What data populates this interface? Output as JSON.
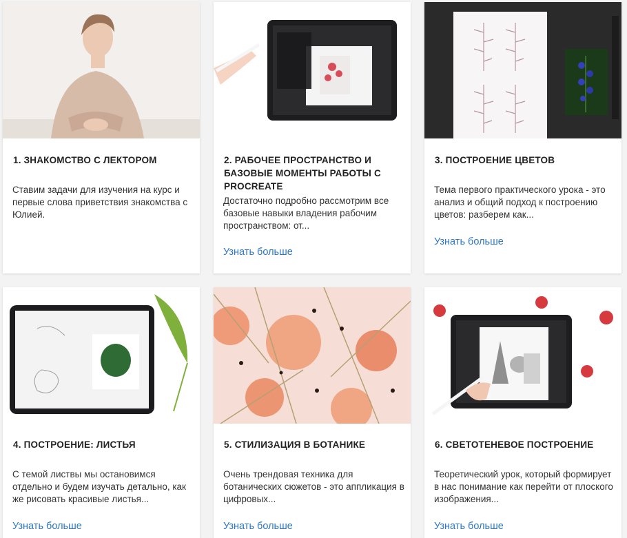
{
  "cards": [
    {
      "title": "1. Знакомство с лектором",
      "description": "Ставим задачи для изучения на курс и первые слова приветствия знакомства с Юлией.",
      "image": "lecturer-photo"
    },
    {
      "title": "2. Рабочее пространство и базовые моменты работы с Procreate",
      "description": "Достаточно подробно рассмотрим все базовые навыки владения рабочим пространством: от...",
      "link": "Узнать больше",
      "image": "tablet-workspace"
    },
    {
      "title": "3. Построение цветов",
      "description": "Тема первого практического урока - это анализ и общий подход к построению цветов: разберем как...",
      "link": "Узнать больше",
      "image": "flower-sketches"
    },
    {
      "title": "4. Построение: листья",
      "description": "С темой листвы мы остановимся отдельно и будем изучать детально, как же рисовать красивые листья...",
      "link": "Узнать больше",
      "image": "leaves-tablet"
    },
    {
      "title": "5. Стилизация в ботанике",
      "description": "Очень трендовая техника для ботанических сюжетов - это аппликация в цифровых...",
      "link": "Узнать больше",
      "image": "botanical-pattern"
    },
    {
      "title": "6. Светотеневое построение",
      "description": "Теоретический урок, который формирует в нас понимание как перейти от плоского изображения...",
      "link": "Узнать больше",
      "image": "shading-tablet"
    }
  ],
  "colors": {
    "link": "#2e77c2",
    "card_bg": "#ffffff",
    "page_bg": "#f3f3f3"
  }
}
